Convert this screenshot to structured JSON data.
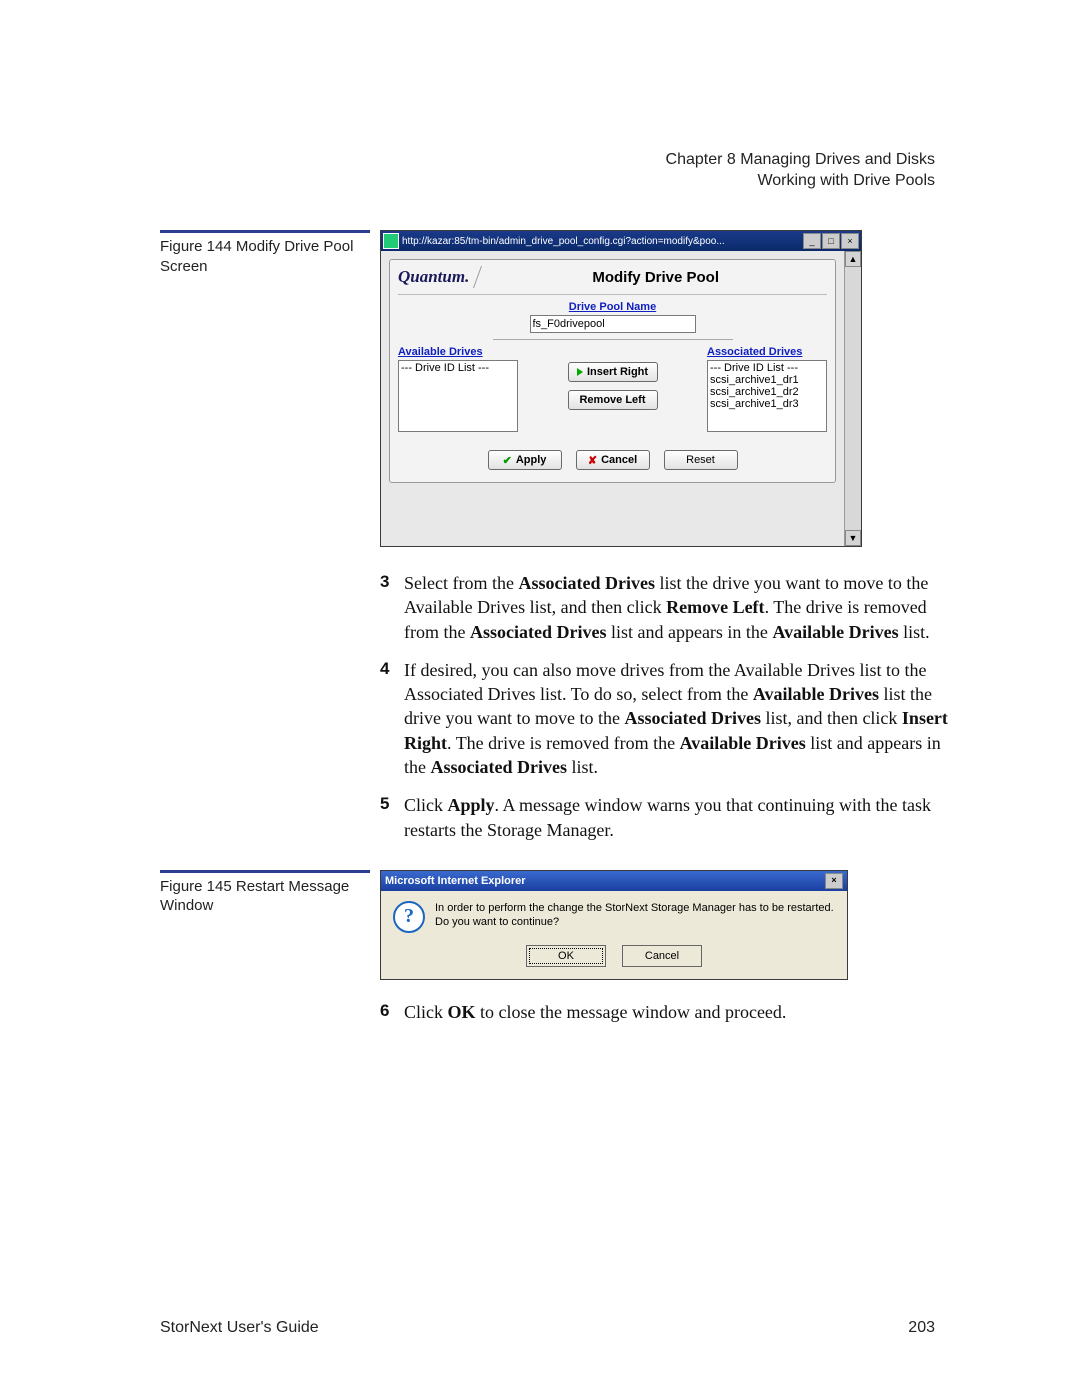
{
  "header": {
    "chapter": "Chapter 8  Managing Drives and Disks",
    "section": "Working with Drive Pools"
  },
  "figure144": {
    "caption": "Figure 144  Modify Drive Pool Screen",
    "window_url": "http://kazar:85/tm-bin/admin_drive_pool_config.cgi?action=modify&poo...",
    "brand": "Quantum.",
    "panel_title": "Modify Drive Pool",
    "pool_name_label": "Drive Pool Name",
    "pool_name_value": "fs_F0drivepool",
    "available_label": "Available Drives",
    "available_items": [
      "--- Drive ID List ---"
    ],
    "associated_label": "Associated Drives",
    "associated_items": [
      "--- Drive ID List ---",
      "scsi_archive1_dr1",
      "scsi_archive1_dr2",
      "scsi_archive1_dr3"
    ],
    "btn_insert": "Insert Right",
    "btn_remove": "Remove Left",
    "btn_apply": "Apply",
    "btn_cancel": "Cancel",
    "btn_reset": "Reset"
  },
  "steps": {
    "s3_a": "Select from the ",
    "s3_b": "Associated Drives",
    "s3_c": " list the drive you want to move to the Available Drives list, and then click ",
    "s3_d": "Remove Left",
    "s3_e": ". The drive is removed from the ",
    "s3_f": "Associated Drives",
    "s3_g": " list and appears in the ",
    "s3_h": "Available Drives",
    "s3_i": " list.",
    "s4_a": "If desired, you can also move drives from the Available Drives list to the Associated Drives list. To do so, select from the ",
    "s4_b": "Available Drives",
    "s4_c": " list the drive you want to move to the ",
    "s4_d": "Associated Drives",
    "s4_e": " list, and then click ",
    "s4_f": "Insert Right",
    "s4_g": ". The drive is removed from the ",
    "s4_h": "Available Drives",
    "s4_i": " list and appears in the ",
    "s4_j": "Associated Drives",
    "s4_k": " list.",
    "s5_a": "Click ",
    "s5_b": "Apply",
    "s5_c": ". A message window warns you that continuing with the task restarts the Storage Manager.",
    "s6_a": "Click ",
    "s6_b": "OK",
    "s6_c": " to close the message window and proceed."
  },
  "figure145": {
    "caption": "Figure 145  Restart Message Window",
    "title": "Microsoft Internet Explorer",
    "line1": "In order to perform the change the StorNext Storage Manager has to be restarted.",
    "line2": "Do you want to continue?",
    "ok": "OK",
    "cancel": "Cancel"
  },
  "footer": {
    "left": "StorNext User's Guide",
    "right": "203"
  }
}
